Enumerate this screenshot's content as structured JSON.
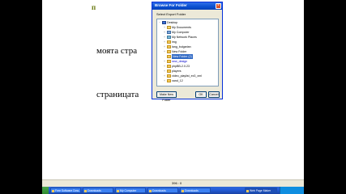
{
  "editor": {
    "page_letter": "п",
    "line1": "моята стра",
    "line2": "страницата"
  },
  "status": {
    "coords": "396 : 0"
  },
  "dialog": {
    "title": "Browse For Folder",
    "close_glyph": "×",
    "instruction": "Select Export Folder",
    "tree": [
      {
        "label": "Desktop",
        "icon": "desktop-icon"
      },
      {
        "label": "My Documents",
        "icon": "documents-folder-icon"
      },
      {
        "label": "My Computer",
        "icon": "computer-icon"
      },
      {
        "label": "My Network Places",
        "icon": "network-icon"
      },
      {
        "label": "img",
        "icon": "folder-icon"
      },
      {
        "label": "lang_bulgarian",
        "icon": "folder-icon"
      },
      {
        "label": "New Folder",
        "icon": "folder-icon"
      },
      {
        "label": "New Folder (2)",
        "icon": "folder-icon"
      },
      {
        "label": "new_design",
        "icon": "folder-icon"
      },
      {
        "label": "phpBB-2.0.23",
        "icon": "folder-icon"
      },
      {
        "label": "players",
        "icon": "folder-icon"
      },
      {
        "label": "video_playlist_ex3_xml",
        "icon": "folder-icon"
      },
      {
        "label": "xand_12",
        "icon": "folder-icon"
      }
    ],
    "buttons": {
      "new_folder": "Make New Folder",
      "ok": "OK",
      "cancel": "Cancel"
    }
  },
  "taskbar": {
    "tasks": [
      "Free Software Dow...",
      "Downloads",
      "My Computer",
      "Downloads",
      "Downloads",
      "Web Page Maker"
    ]
  }
}
